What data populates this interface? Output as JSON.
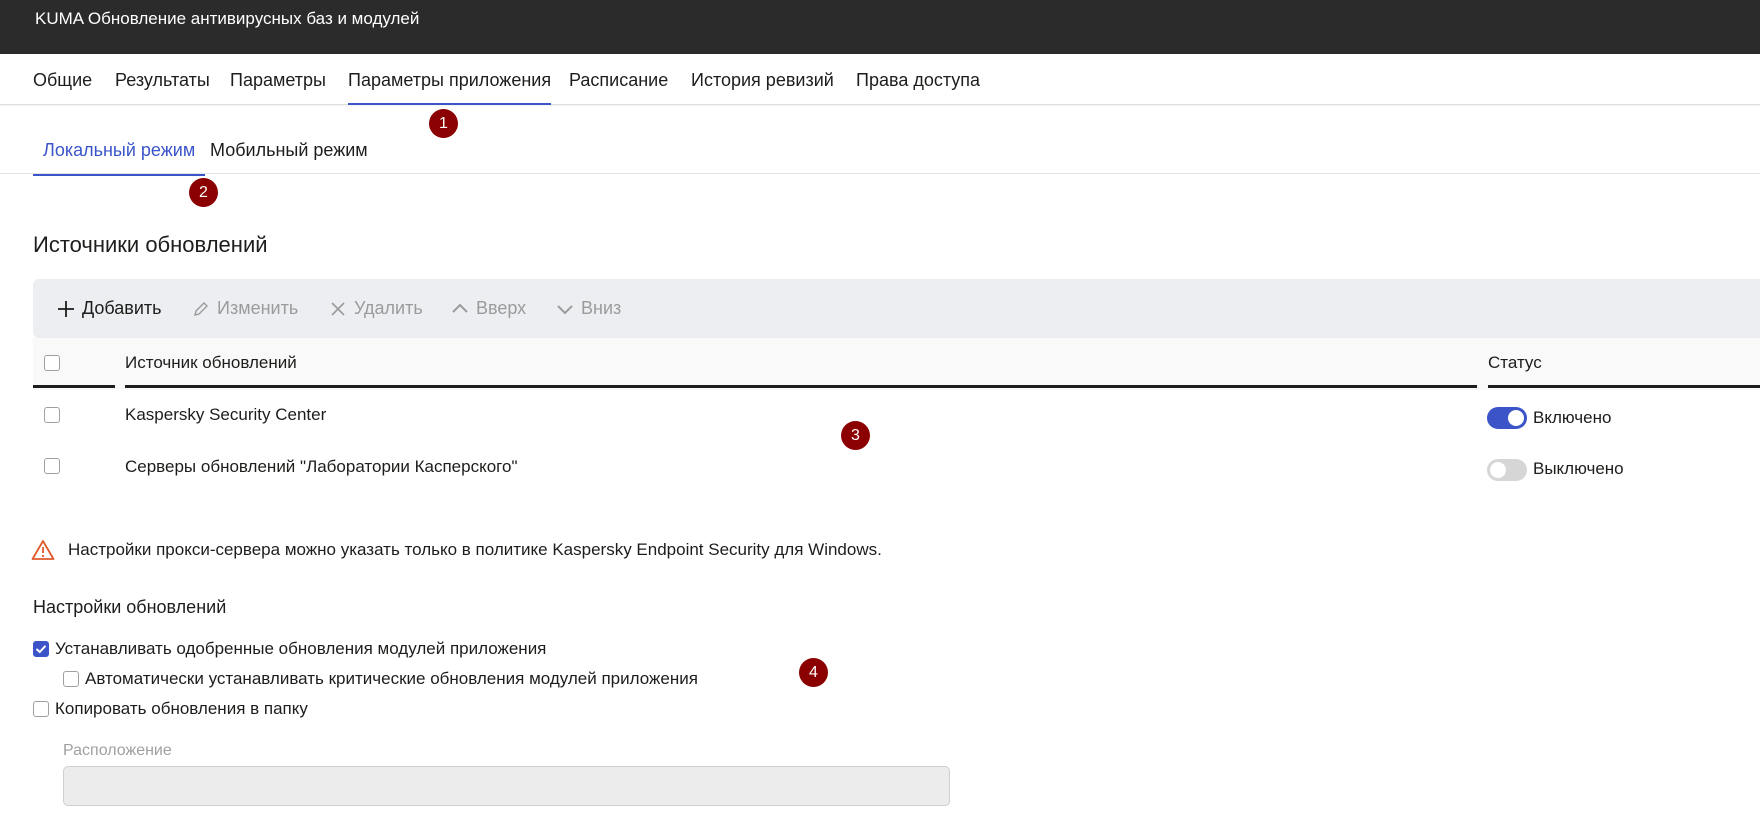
{
  "window": {
    "title": "KUMA Обновление антивирусных баз и модулей"
  },
  "tabs": [
    {
      "label": "Общие"
    },
    {
      "label": "Результаты"
    },
    {
      "label": "Параметры"
    },
    {
      "label": "Параметры приложения",
      "active": true
    },
    {
      "label": "Расписание"
    },
    {
      "label": "История ревизий"
    },
    {
      "label": "Права доступа"
    }
  ],
  "subtabs": [
    {
      "label": "Локальный режим",
      "active": true
    },
    {
      "label": "Мобильный режим"
    }
  ],
  "badges": [
    "1",
    "2",
    "3",
    "4"
  ],
  "sources": {
    "title": "Источники обновлений",
    "toolbar": {
      "add": "Добавить",
      "edit": "Изменить",
      "delete": "Удалить",
      "up": "Вверх",
      "down": "Вниз"
    },
    "columns": {
      "source": "Источник обновлений",
      "status": "Статус"
    },
    "rows": [
      {
        "source": "Kaspersky Security Center",
        "status": "Включено",
        "enabled": true
      },
      {
        "source": "Серверы обновлений \"Лаборатории Касперского\"",
        "status": "Выключено",
        "enabled": false
      }
    ]
  },
  "warning": {
    "text": "Настройки прокси-сервера можно указать только в политике Kaspersky Endpoint Security для Windows."
  },
  "settings": {
    "title": "Настройки обновлений",
    "install_approved": {
      "label": "Устанавливать одобренные обновления модулей приложения",
      "checked": true
    },
    "auto_critical": {
      "label": "Автоматически устанавливать критические обновления модулей приложения",
      "checked": false
    },
    "copy_to_folder": {
      "label": "Копировать обновления в папку",
      "checked": false
    },
    "location": {
      "label": "Расположение",
      "value": ""
    }
  },
  "colors": {
    "accent": "#3b55c9",
    "titlebar": "#2b2b2b",
    "badge": "#8b0000",
    "warning": "#e05a2b"
  }
}
